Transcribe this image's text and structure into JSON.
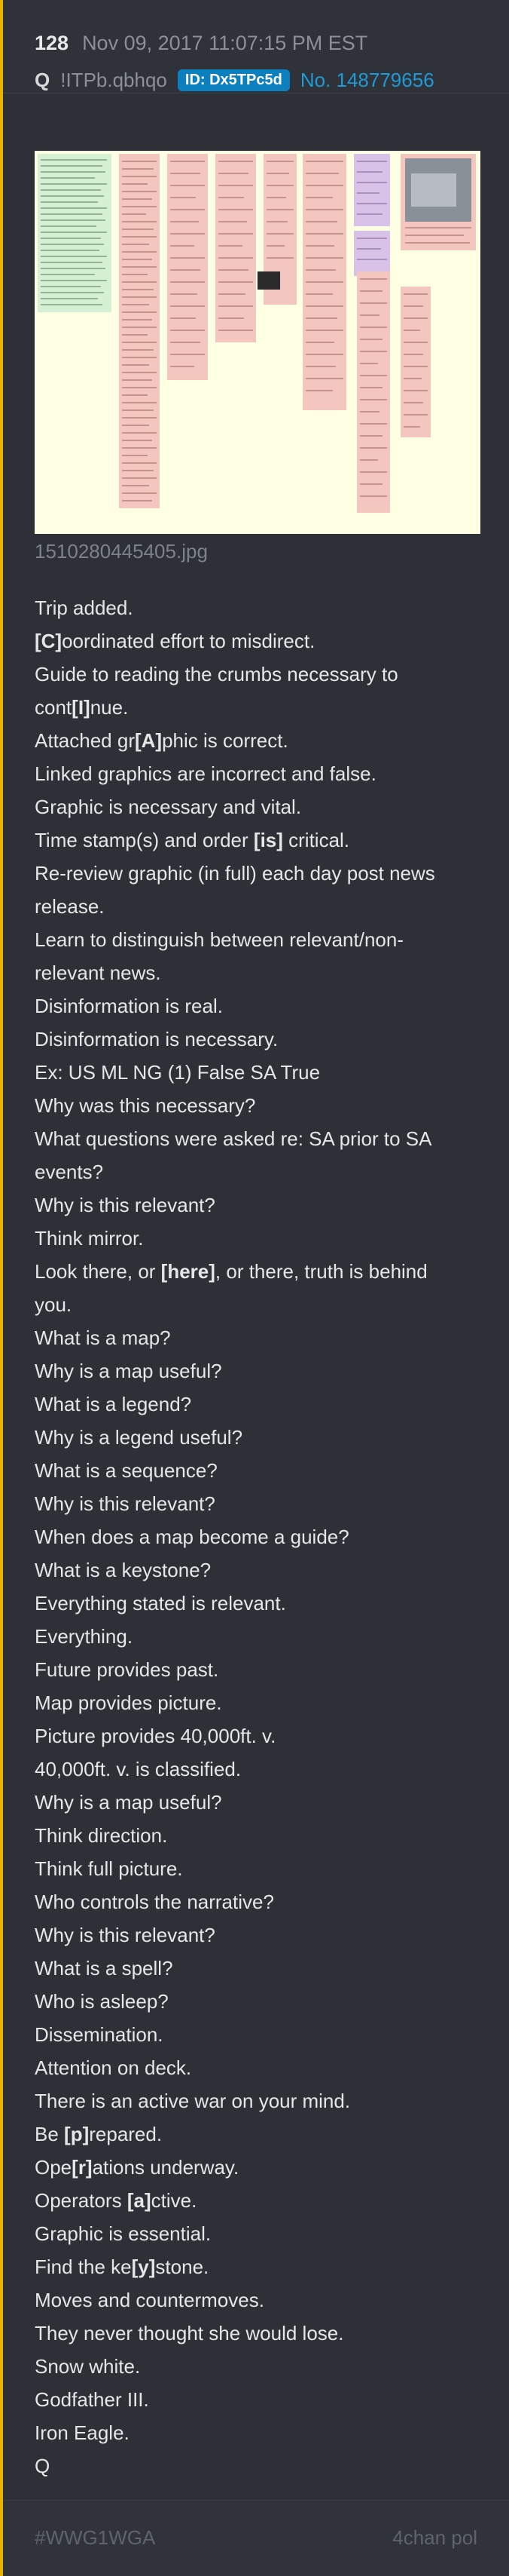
{
  "post": {
    "number": "128",
    "timestamp": "Nov 09, 2017 11:07:15 PM EST",
    "author": "Q",
    "tripcode": "!ITPb.qbhqo",
    "id_badge": "ID: Dx5TPc5d",
    "post_no": "No. 148779656"
  },
  "attachment": {
    "filename": "1510280445405.jpg"
  },
  "body": {
    "lines": [
      [
        "Trip added."
      ],
      [
        "[C]",
        "oordinated effort to misdirect."
      ],
      [
        "Guide to reading the crumbs necessary to"
      ],
      [
        "cont",
        "[I]",
        "nue."
      ],
      [
        "Attached gr",
        "[A]",
        "phic is correct."
      ],
      [
        "Linked graphics are incorrect and false."
      ],
      [
        "Graphic is necessary and vital."
      ],
      [
        "Time stamp(s) and order ",
        "[is]",
        " critical."
      ],
      [
        "Re-review graphic (in full) each day post news"
      ],
      [
        "release."
      ],
      [
        "Learn to distinguish between relevant/non-"
      ],
      [
        "relevant news."
      ],
      [
        "Disinformation is real."
      ],
      [
        "Disinformation is necessary."
      ],
      [
        "Ex: US ML NG (1) False SA True"
      ],
      [
        "Why was this necessary?"
      ],
      [
        "What questions were asked re: SA prior to SA"
      ],
      [
        "events?"
      ],
      [
        "Why is this relevant?"
      ],
      [
        "Think mirror."
      ],
      [
        "Look there, or ",
        "[here]",
        ", or there, truth is behind"
      ],
      [
        "you."
      ],
      [
        "What is a map?"
      ],
      [
        "Why is a map useful?"
      ],
      [
        "What is a legend?"
      ],
      [
        "Why is a legend useful?"
      ],
      [
        "What is a sequence?"
      ],
      [
        "Why is this relevant?"
      ],
      [
        "When does a map become a guide?"
      ],
      [
        "What is a keystone?"
      ],
      [
        "Everything stated is relevant."
      ],
      [
        "Everything."
      ],
      [
        "Future provides past."
      ],
      [
        "Map provides picture."
      ],
      [
        "Picture provides 40,000ft. v."
      ],
      [
        "40,000ft. v. is classified."
      ],
      [
        "Why is a map useful?"
      ],
      [
        "Think direction."
      ],
      [
        "Think full picture."
      ],
      [
        "Who controls the narrative?"
      ],
      [
        "Why is this relevant?"
      ],
      [
        "What is a spell?"
      ],
      [
        "Who is asleep?"
      ],
      [
        "Dissemination."
      ],
      [
        "Attention on deck."
      ],
      [
        "There is an active war on your mind."
      ],
      [
        "Be ",
        "[p]",
        "repared."
      ],
      [
        "Ope",
        "[r]",
        "ations underway."
      ],
      [
        "Operators ",
        "[a]",
        "ctive."
      ],
      [
        "Graphic is essential."
      ],
      [
        "Find the ke",
        "[y]",
        "stone."
      ],
      [
        "Moves and countermoves."
      ],
      [
        "They never thought she would lose."
      ],
      [
        "Snow white."
      ],
      [
        "Godfather III."
      ],
      [
        "Iron Eagle."
      ],
      [
        "Q"
      ]
    ]
  },
  "footer": {
    "hashtag": "#WWG1WGA",
    "source": "4chan pol"
  },
  "colors": {
    "accent_bar": "#e8b400",
    "id_badge": "#0c7fbf",
    "link": "#1e9ad6",
    "card_bg": "#2d3137"
  }
}
